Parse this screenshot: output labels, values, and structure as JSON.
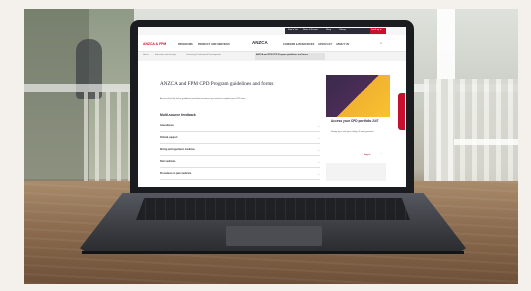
{
  "screen": {
    "utility_nav": [
      "Find a Vet",
      "News & Events",
      "Shop",
      "Library",
      "Join/Log in"
    ],
    "main_nav": [
      "PROGRAMS",
      "PRODUCT AND SERVICES",
      "CAREERS & RESOURCES",
      "ADVOCACY",
      "ABOUT US"
    ],
    "logo_left": "ANZCA & FPM",
    "logo_center": "ANZCA",
    "breadcrumb": [
      "Home",
      "Education and training",
      "Continuing Professional Development"
    ],
    "breadcrumb_current": "ANZCA and FPM CPD Program guidelines and forms",
    "page_title": "ANZCA and FPM CPD Program guidelines and forms",
    "intro": "Access all of the forms, guidelines and other resources you need to complete your CPD here.",
    "section_title": "Multi-source feedback",
    "accordion": [
      "Anaesthesia",
      "Clinical support",
      "Diving and hyperbaric medicine",
      "Pain medicine",
      "Procedures in pain medicine"
    ],
    "promo": {
      "title": "Access your CPD portfolio 24/7",
      "body": "Simply log in with your college ID and password",
      "link": "Log in"
    }
  },
  "colors": {
    "brand_red": "#c8102e",
    "brand_navy": "#2b2b3a",
    "hero_purple": "#4b2d57",
    "hero_yellow": "#f7c230"
  }
}
